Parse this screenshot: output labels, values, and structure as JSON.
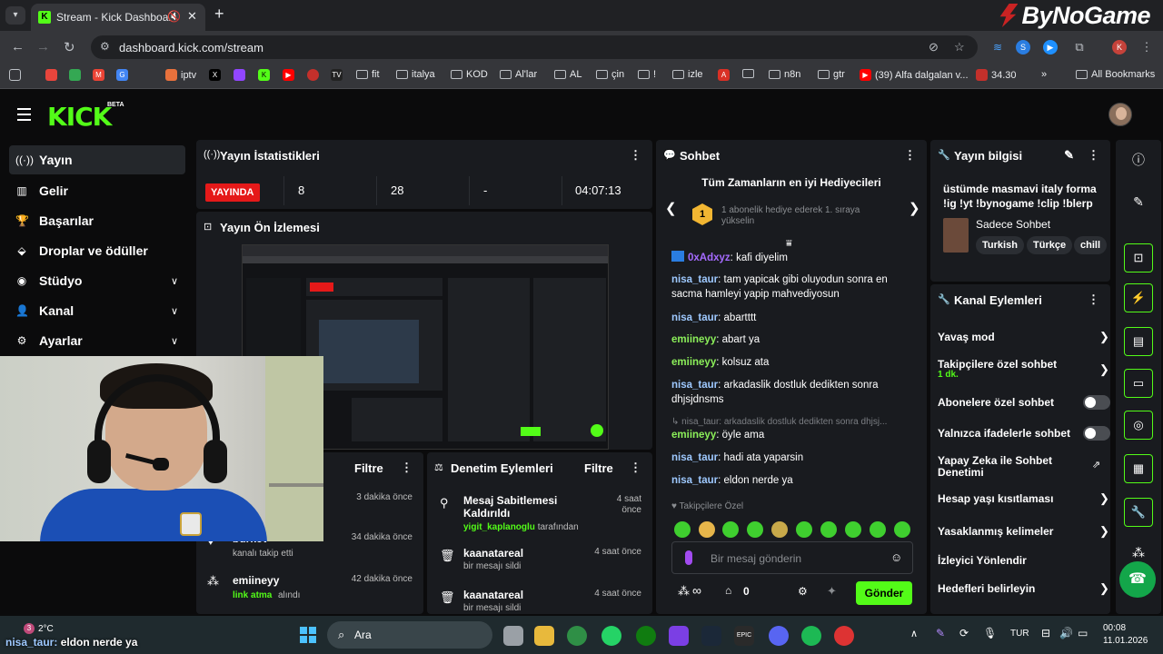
{
  "browser": {
    "tab_title": "Stream - Kick Dashboard",
    "url": "dashboard.kick.com/stream",
    "brand_logo": "ByNoGame",
    "bookmarks": [
      "iptv",
      "fit",
      "italya",
      "KOD",
      "Al'lar",
      "AL",
      "çin",
      "!",
      "izle",
      "n8n",
      "gtr",
      "(39) Alfa dalgalan v...",
      "34.30",
      "All Bookmarks"
    ]
  },
  "app": {
    "logo": "KICK",
    "logo_badge": "BETA"
  },
  "sidebar": {
    "items": [
      {
        "label": "Yayın",
        "icon": "broadcast-icon"
      },
      {
        "label": "Gelir",
        "icon": "revenue-icon"
      },
      {
        "label": "Başarılar",
        "icon": "trophy-icon"
      },
      {
        "label": "Droplar ve ödüller",
        "icon": "drops-icon"
      },
      {
        "label": "Stüdyo",
        "icon": "studio-icon"
      },
      {
        "label": "Kanal",
        "icon": "channel-icon"
      },
      {
        "label": "Ayarlar",
        "icon": "settings-icon"
      }
    ]
  },
  "stats": {
    "title": "Yayın İstatistikleri",
    "live_label": "YAYINDA",
    "viewers": "8",
    "followers": "28",
    "subs": "-",
    "duration": "04:07:13"
  },
  "preview": {
    "title": "Yayın Ön İzlemesi"
  },
  "feed": {
    "filter_label": "Filtre",
    "items": [
      {
        "time": "3 dakika önce"
      },
      {
        "user": "burkev",
        "action": "kanalı takip etti",
        "time": "34 dakika önce"
      },
      {
        "user": "emiineyy",
        "action_highlight": "link atma",
        "action": "alındı",
        "time": "42 dakika önce"
      }
    ]
  },
  "mod_actions": {
    "title": "Denetim Eylemleri",
    "filter_label": "Filtre",
    "items": [
      {
        "title": "Mesaj Sabitlemesi Kaldırıldı",
        "by": "yigit_kaplanoglu",
        "by_suffix": "tarafından",
        "time": "4 saat önce"
      },
      {
        "title": "kaanatareal",
        "detail": "bir mesajı sildi",
        "time": "4 saat önce"
      },
      {
        "title": "kaanatareal",
        "detail": "bir mesajı sildi",
        "time": "4 saat önce"
      }
    ]
  },
  "chat": {
    "title": "Sohbet",
    "gift_title": "Tüm Zamanların en iyi Hediyecileri",
    "gift_rank": "1",
    "gift_text": "1 abonelik hediye ederek 1. sıraya yükselin",
    "messages": [
      {
        "user": "0xAdxyz",
        "text": "kafi diyelim",
        "color": "#a56bff"
      },
      {
        "user": "nisa_taur",
        "text": "tam yapicak gibi oluyodun sonra en sacma hamleyi yapip mahvediyosun",
        "color": "#9ec9ff"
      },
      {
        "user": "nisa_taur",
        "text": "abartttt",
        "color": "#9ec9ff"
      },
      {
        "user": "emiineyy",
        "text": "abart ya",
        "color": "#8cf05a"
      },
      {
        "user": "emiineyy",
        "text": "kolsuz ata",
        "color": "#8cf05a"
      },
      {
        "user": "nisa_taur",
        "text": "arkadaslik dostluk dedikten sonra dhjsjdnsms",
        "color": "#9ec9ff"
      },
      {
        "user": "emiineyy",
        "text": "öyle ama",
        "color": "#8cf05a"
      },
      {
        "user": "nisa_taur",
        "text": "hadi ata yaparsin",
        "color": "#9ec9ff"
      },
      {
        "user": "nisa_taur",
        "text": "eldon nerde ya",
        "color": "#9ec9ff"
      }
    ],
    "reply_preview": "nisa_taur: arkadaslik dostluk dedikten sonra dhjsj...",
    "followers_only": "Takipçilere Özel",
    "input_placeholder": "Bir mesaj gönderin",
    "points": "∞",
    "gift_count": "0",
    "send_label": "Gönder"
  },
  "stream_info": {
    "title": "Yayın bilgisi",
    "stream_title": "üstümde masmavi italy forma !ig !yt !bynogame !clip !blerp",
    "category": "Sadece Sohbet",
    "tags": [
      "Turkish",
      "Türkçe",
      "chill"
    ]
  },
  "channel_actions": {
    "title": "Kanal Eylemleri",
    "items": [
      {
        "label": "Yavaş mod",
        "control": "chevron"
      },
      {
        "label": "Takipçilere özel sohbet",
        "sub": "1 dk.",
        "control": "chevron"
      },
      {
        "label": "Abonelere özel sohbet",
        "control": "toggle"
      },
      {
        "label": "Yalnızca ifadelerle sohbet",
        "control": "toggle"
      },
      {
        "label": "Yapay Zeka ile Sohbet Denetimi",
        "control": "external"
      },
      {
        "label": "Hesap yaşı kısıtlaması",
        "control": "chevron"
      },
      {
        "label": "Yasaklanmış kelimeler",
        "control": "chevron"
      },
      {
        "label": "İzleyici Yönlendir",
        "control": "none"
      },
      {
        "label": "Hedefleri belirleyin",
        "control": "chevron"
      }
    ]
  },
  "taskbar": {
    "weather_temp": "2°C",
    "search_label": "Ara",
    "language": "TUR",
    "time": "00:08",
    "date": "11.01.2026",
    "overlay_user": "nisa_taur:",
    "overlay_text": "eldon nerde ya"
  },
  "colors": {
    "accent": "#53fc18",
    "live": "#e51919",
    "panel": "#191b1f",
    "background": "#0b0b0c"
  }
}
